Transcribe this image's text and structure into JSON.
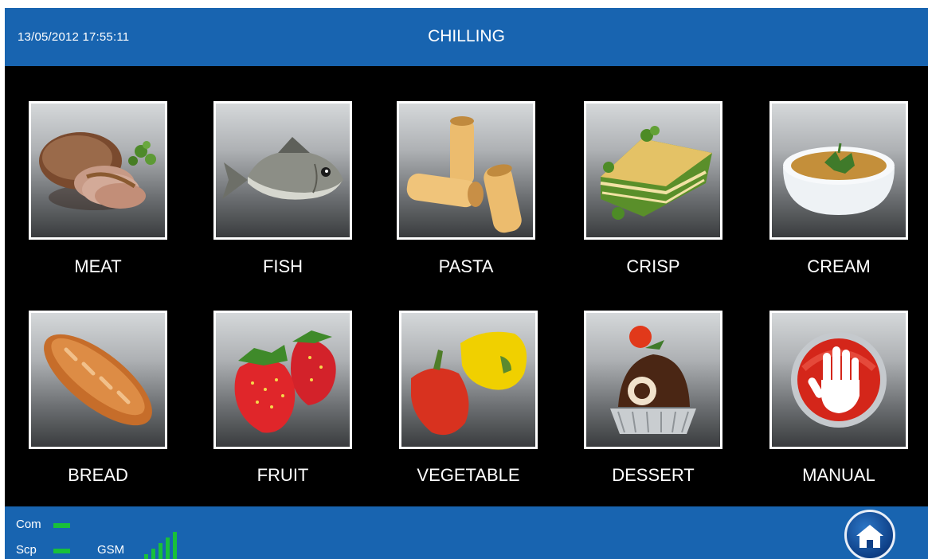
{
  "header": {
    "datetime": "13/05/2012 17:55:11",
    "title": "CHILLING"
  },
  "programs": [
    {
      "label": "MEAT",
      "icon": "meat-icon"
    },
    {
      "label": "FISH",
      "icon": "fish-icon"
    },
    {
      "label": "PASTA",
      "icon": "pasta-icon"
    },
    {
      "label": "CRISP",
      "icon": "crisp-icon"
    },
    {
      "label": "CREAM",
      "icon": "cream-icon"
    },
    {
      "label": "BREAD",
      "icon": "bread-icon"
    },
    {
      "label": "FRUIT",
      "icon": "fruit-icon"
    },
    {
      "label": "VEGETABLE",
      "icon": "vegetable-icon"
    },
    {
      "label": "DESSERT",
      "icon": "dessert-icon"
    },
    {
      "label": "MANUAL",
      "icon": "manual-stop-hand-icon"
    }
  ],
  "footer": {
    "com_label": "Com",
    "scp_label": "Scp",
    "gsm_label": "GSM",
    "gsm_signal_bars": 5,
    "status_color": "#18c03a",
    "home_icon": "home-icon"
  },
  "colors": {
    "bar_blue": "#1864b0",
    "background": "#000000",
    "tile_border": "#ffffff"
  }
}
